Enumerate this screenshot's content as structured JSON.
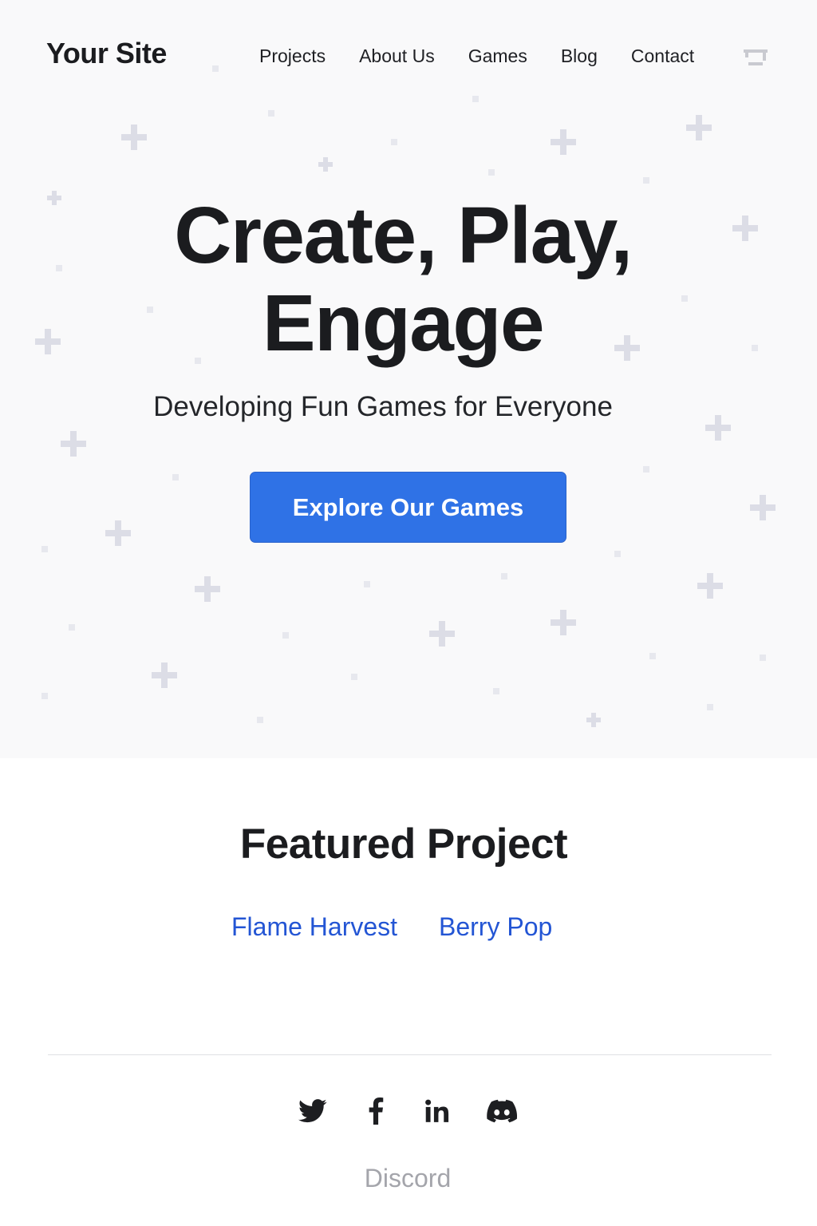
{
  "header": {
    "logo": "Your Site",
    "nav": [
      "Projects",
      "About Us",
      "Games",
      "Blog",
      "Contact"
    ],
    "menu_icon": "menu-icon"
  },
  "hero": {
    "title_line1": "Create, Play,",
    "title_line2": "Engage",
    "subtitle": "Developing Fun Games for Everyone",
    "cta_label": "Explore Our Games"
  },
  "featured": {
    "title": "Featured Project",
    "projects": [
      "Flame Harvest",
      "Berry Pop"
    ]
  },
  "footer": {
    "social_icons": [
      "twitter-icon",
      "facebook-icon",
      "linkedin-icon",
      "discord-icon"
    ],
    "label": "Discord"
  },
  "colors": {
    "accent": "#2f72e6",
    "link": "#2355d4",
    "text": "#1b1c1f",
    "muted": "#a4a5ab",
    "background": "#f9f9fa"
  }
}
